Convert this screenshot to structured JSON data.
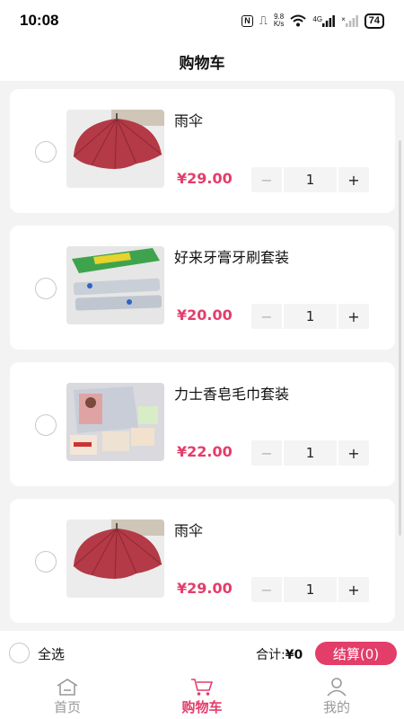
{
  "status_bar": {
    "time": "10:08",
    "nfc": "N",
    "vibrate": "⎍",
    "net_speed_value": "9.8",
    "net_speed_unit": "K/s",
    "signal_label": "4G",
    "signal2_label": "×",
    "battery": "74"
  },
  "header": {
    "title": "购物车"
  },
  "cart": {
    "currency": "¥",
    "items": [
      {
        "name": "雨伞",
        "price": "¥29.00",
        "quantity": "1",
        "image": "umbrella"
      },
      {
        "name": "好来牙膏牙刷套装",
        "price": "¥20.00",
        "quantity": "1",
        "image": "toothbrush-set"
      },
      {
        "name": "力士香皂毛巾套装",
        "price": "¥22.00",
        "quantity": "1",
        "image": "soap-towel-set"
      },
      {
        "name": "雨伞",
        "price": "¥29.00",
        "quantity": "1",
        "image": "umbrella"
      }
    ],
    "minus_symbol": "−",
    "plus_symbol": "+"
  },
  "checkout": {
    "select_all_label": "全选",
    "total_label": "合计:",
    "total_value": "¥0",
    "checkout_button": "结算(0)"
  },
  "tabbar": {
    "tabs": [
      {
        "label": "首页",
        "icon": "home-icon",
        "active": false
      },
      {
        "label": "购物车",
        "icon": "cart-icon",
        "active": true
      },
      {
        "label": "我的",
        "icon": "user-icon",
        "active": false
      }
    ]
  },
  "colors": {
    "accent": "#e33d6a",
    "background": "#f3f3f3",
    "inactive_tab": "#999999"
  }
}
